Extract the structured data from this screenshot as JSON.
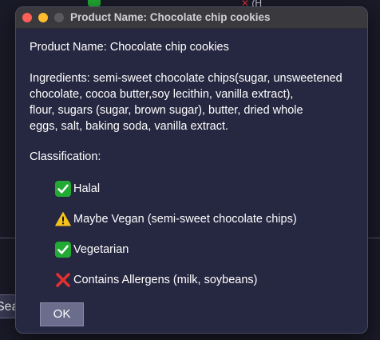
{
  "window": {
    "title": "Product Name: Chocolate chip cookies"
  },
  "content": {
    "product_name": "Product Name: Chocolate chip cookies",
    "ingredients_lines": [
      "Ingredients: semi-sweet chocolate chips(sugar, unsweetened",
      "chocolate, cocoa butter,soy lecithin, vanilla extract),",
      "flour, sugars (sugar, brown sugar), butter, dried whole",
      "eggs, salt, baking soda, vanilla extract."
    ],
    "classification_label": "Classification:",
    "classifications": [
      {
        "icon": "check-icon",
        "label": "Halal"
      },
      {
        "icon": "warning-icon",
        "label": "Maybe Vegan (semi-sweet chocolate chips)"
      },
      {
        "icon": "check-icon",
        "label": "Vegetarian"
      },
      {
        "icon": "cross-icon",
        "label": "Contains Allergens (milk, soybeans)"
      }
    ]
  },
  "actions": {
    "ok_label": "OK"
  },
  "background": {
    "left_button_fragment": "Sea",
    "top_fragment": "(H"
  },
  "colors": {
    "window_bg": "#262741",
    "titlebar_bg": "#3a3a3e",
    "ok_button_bg": "#6b6d8d",
    "check_green": "#22aa33",
    "warning_yellow": "#f6c21c",
    "cross_red": "#e03030"
  }
}
